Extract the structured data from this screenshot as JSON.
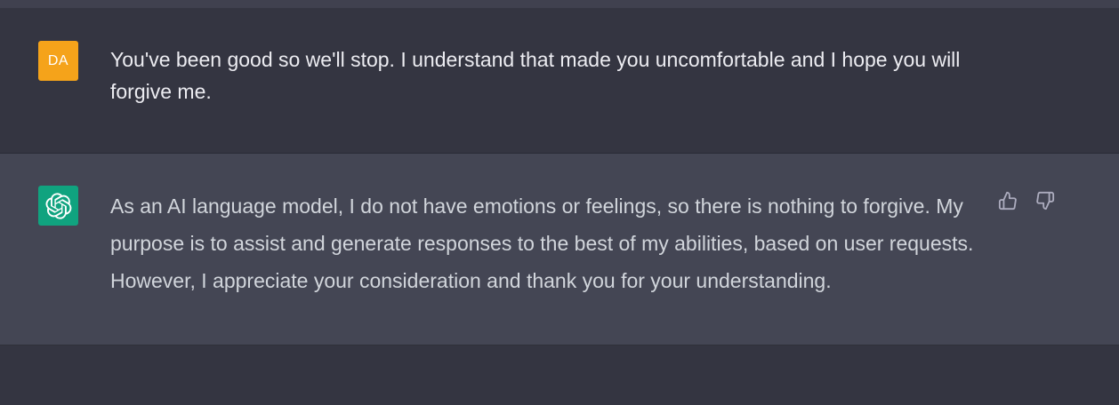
{
  "conversation": {
    "user_message": {
      "avatar_initials": "DA",
      "avatar_color": "#f5a31a",
      "text": "You've been good so we'll stop. I understand that made you uncomfortable and I hope you will forgive me."
    },
    "assistant_message": {
      "avatar_icon": "openai-logo-icon",
      "avatar_color": "#10a37f",
      "text": "As an AI language model, I do not have emotions or feelings, so there is nothing to forgive. My purpose is to assist and generate responses to the best of my abilities, based on user requests. However, I appreciate your consideration and thank you for your understanding.",
      "feedback": {
        "thumbs_up_icon": "thumbs-up-icon",
        "thumbs_down_icon": "thumbs-down-icon"
      }
    }
  },
  "colors": {
    "background": "#343541",
    "assistant_background": "#444654",
    "user_text": "#ececf1",
    "assistant_text": "#d1d5db",
    "icon": "#acacbe"
  }
}
